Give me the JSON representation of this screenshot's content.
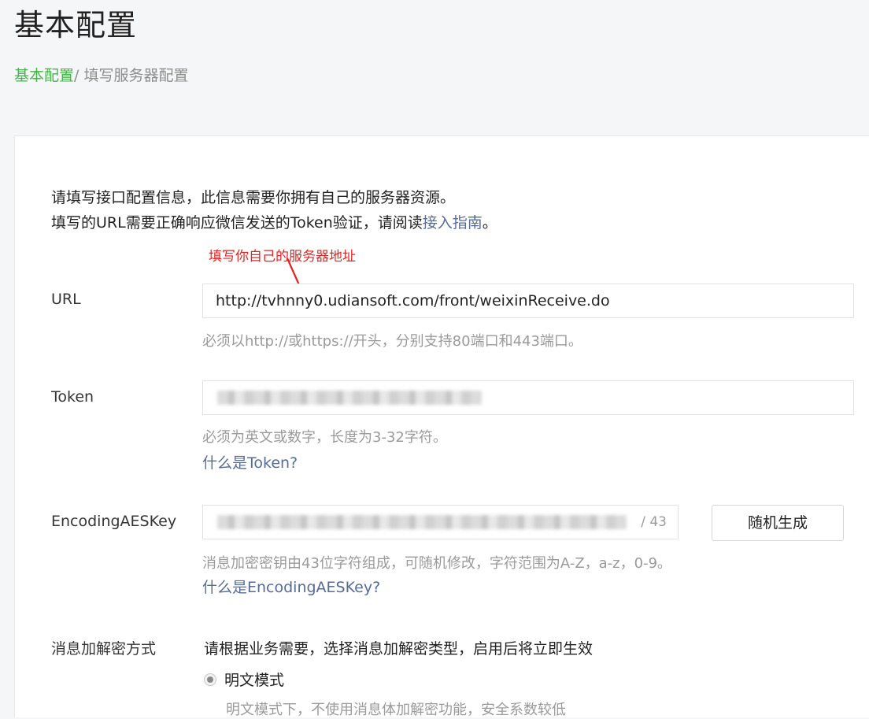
{
  "page": {
    "title": "基本配置"
  },
  "breadcrumb": {
    "root": "基本配置",
    "separator": "/ ",
    "current": "填写服务器配置"
  },
  "intro": {
    "line1": "请填写接口配置信息，此信息需要你拥有自己的服务器资源。",
    "line2_prefix": "填写的URL需要正确响应微信发送的Token验证，请阅读",
    "guide_link": "接入指南",
    "line2_suffix": "。"
  },
  "annotation": {
    "text": "填写你自己的服务器地址",
    "color": "#e02424"
  },
  "form": {
    "url": {
      "label": "URL",
      "value": "http://tvhnny0.udiansoft.com/front/weixinReceive.do",
      "hint": "必须以http://或https://开头，分别支持80端口和443端口。"
    },
    "token": {
      "label": "Token",
      "hint": "必须为英文或数字，长度为3-32字符。",
      "help_link": "什么是Token?"
    },
    "aes": {
      "label": "EncodingAESKey",
      "counter": "/ 43",
      "generate_button": "随机生成",
      "hint": "消息加密密钥由43位字符组成，可随机修改，字符范围为A-Z，a-z，0-9。",
      "help_link": "什么是EncodingAESKey?"
    },
    "encryption": {
      "label": "消息加解密方式",
      "description": "请根据业务需要，选择消息加解密类型，启用后将立即生效",
      "options": [
        {
          "label": "明文模式",
          "selected": true,
          "desc": "明文模式下，不使用消息体加解密功能，安全系数较低"
        }
      ]
    }
  },
  "colors": {
    "accent_green": "#44b549",
    "link_blue": "#576b95",
    "hint_gray": "#9a9a9a"
  }
}
